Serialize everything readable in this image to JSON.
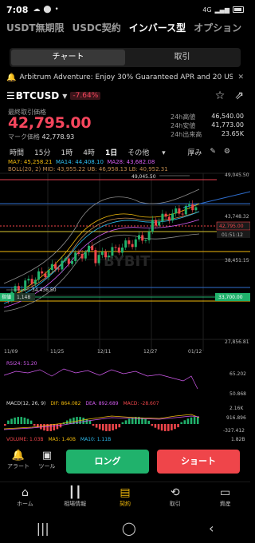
{
  "status": {
    "time": "7:08",
    "icons": [
      "☁",
      "⬤",
      "•"
    ],
    "network": "4G"
  },
  "product_tabs": [
    "USDT無期限",
    "USDC契約",
    "インバース型",
    "オプション"
  ],
  "product_tab_active": 2,
  "segments": {
    "chart": "チャート",
    "trade": "取引"
  },
  "banner": {
    "text": "Arbitrum Adventure: Enjoy 30% Guaranteed APR and 20 US..."
  },
  "symbol": {
    "name": "BTCUSD",
    "change": "-7.64%"
  },
  "price": {
    "label": "最終取引価格",
    "last": "42,795.00",
    "mark_label": "マーク価格",
    "mark": "42,778.93"
  },
  "stats": [
    {
      "label": "24h高値",
      "value": "46,540.00"
    },
    {
      "label": "24h安値",
      "value": "41,773.00"
    },
    {
      "label": "24h出来高",
      "value": "23.65K"
    }
  ],
  "intervals": [
    "時間",
    "15分",
    "1時",
    "4時",
    "1日",
    "その他"
  ],
  "interval_active": "1日",
  "depth_label": "厚み",
  "ma": {
    "ma7": "MA7: 45,258.21",
    "ma14": "MA14: 44,408.10",
    "ma28": "MA28: 43,682.08"
  },
  "boll": "BOLL(20, 2) MID: 43,955.22  UB: 46,958.13  LB: 40,952.31",
  "chart_data": {
    "type": "candlestick",
    "y_ticks": [
      "49,045.50",
      "43,748.32",
      "38,451.15",
      "33,153.97",
      "27,856.81"
    ],
    "price_labels": {
      "last": "42,795.00",
      "countdown": "01:51:12",
      "liq": "33,700.00"
    },
    "annotations": {
      "high": "49,045.50",
      "low": "34,436.50"
    },
    "position": {
      "tag": "指値",
      "qty": "1,148"
    },
    "x_ticks": [
      "11/09",
      "11/25",
      "12/11",
      "12/27",
      "01/12"
    ],
    "watermark": "BYBIT",
    "rsi": {
      "label": "RSI24: 51.20",
      "ticks": [
        "65.202",
        "50.868"
      ]
    },
    "macd": {
      "label": "MACD(12, 26, 9)",
      "dif": "DIF: 864.082",
      "dea": "DEA: 892.689",
      "macd": "MACD: -28.607",
      "ticks": [
        "2.16K",
        "916.896",
        "-327.412"
      ]
    },
    "volume": {
      "vol": "VOLUME: 1.03B",
      "ma5": "MA5: 1.40B",
      "ma10": "MA10: 1.11B",
      "tick": "1.82B"
    }
  },
  "actions": {
    "alert": "アラート",
    "tool": "ツール",
    "long": "ロング",
    "short": "ショート"
  },
  "bottom_nav": [
    "ホーム",
    "相場情報",
    "契約",
    "取引",
    "資産"
  ],
  "bottom_nav_active": 2,
  "colors": {
    "up": "#20b26c",
    "down": "#ef454a",
    "accent": "#f0b90b"
  }
}
